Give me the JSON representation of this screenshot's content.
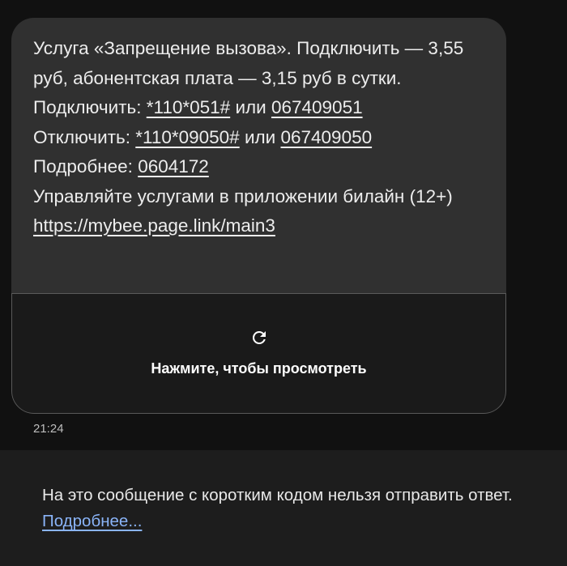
{
  "message": {
    "line1": "Услуга «Запрещение вызова». Подключить — 3,55 руб, абонентская плата — 3,15 руб в сутки.",
    "connect_label": "Подключить: ",
    "connect_code": "*110*051#",
    "or1": " или ",
    "connect_number": "067409051",
    "disconnect_label": "Отключить: ",
    "disconnect_code": "*110*09050#",
    "or2": " или ",
    "disconnect_number": "067409050",
    "details_label": "Подробнее: ",
    "details_number": "0604172",
    "manage_text": "Управляйте услугами в приложении билайн (12+) ",
    "manage_link": "https://mybee.page.link/main3"
  },
  "preview": {
    "icon": "reload-icon",
    "label": "Нажмите, чтобы просмотреть"
  },
  "timestamp": "21:24",
  "footer": {
    "text": "На это сообщение с коротким кодом нельзя отправить ответ. ",
    "link": "Подробнее..."
  },
  "colors": {
    "background": "#111111",
    "bubble": "#303030",
    "preview": "#1a1a1a",
    "footer": "#1d1d1d",
    "link": "#8ab4f8"
  }
}
